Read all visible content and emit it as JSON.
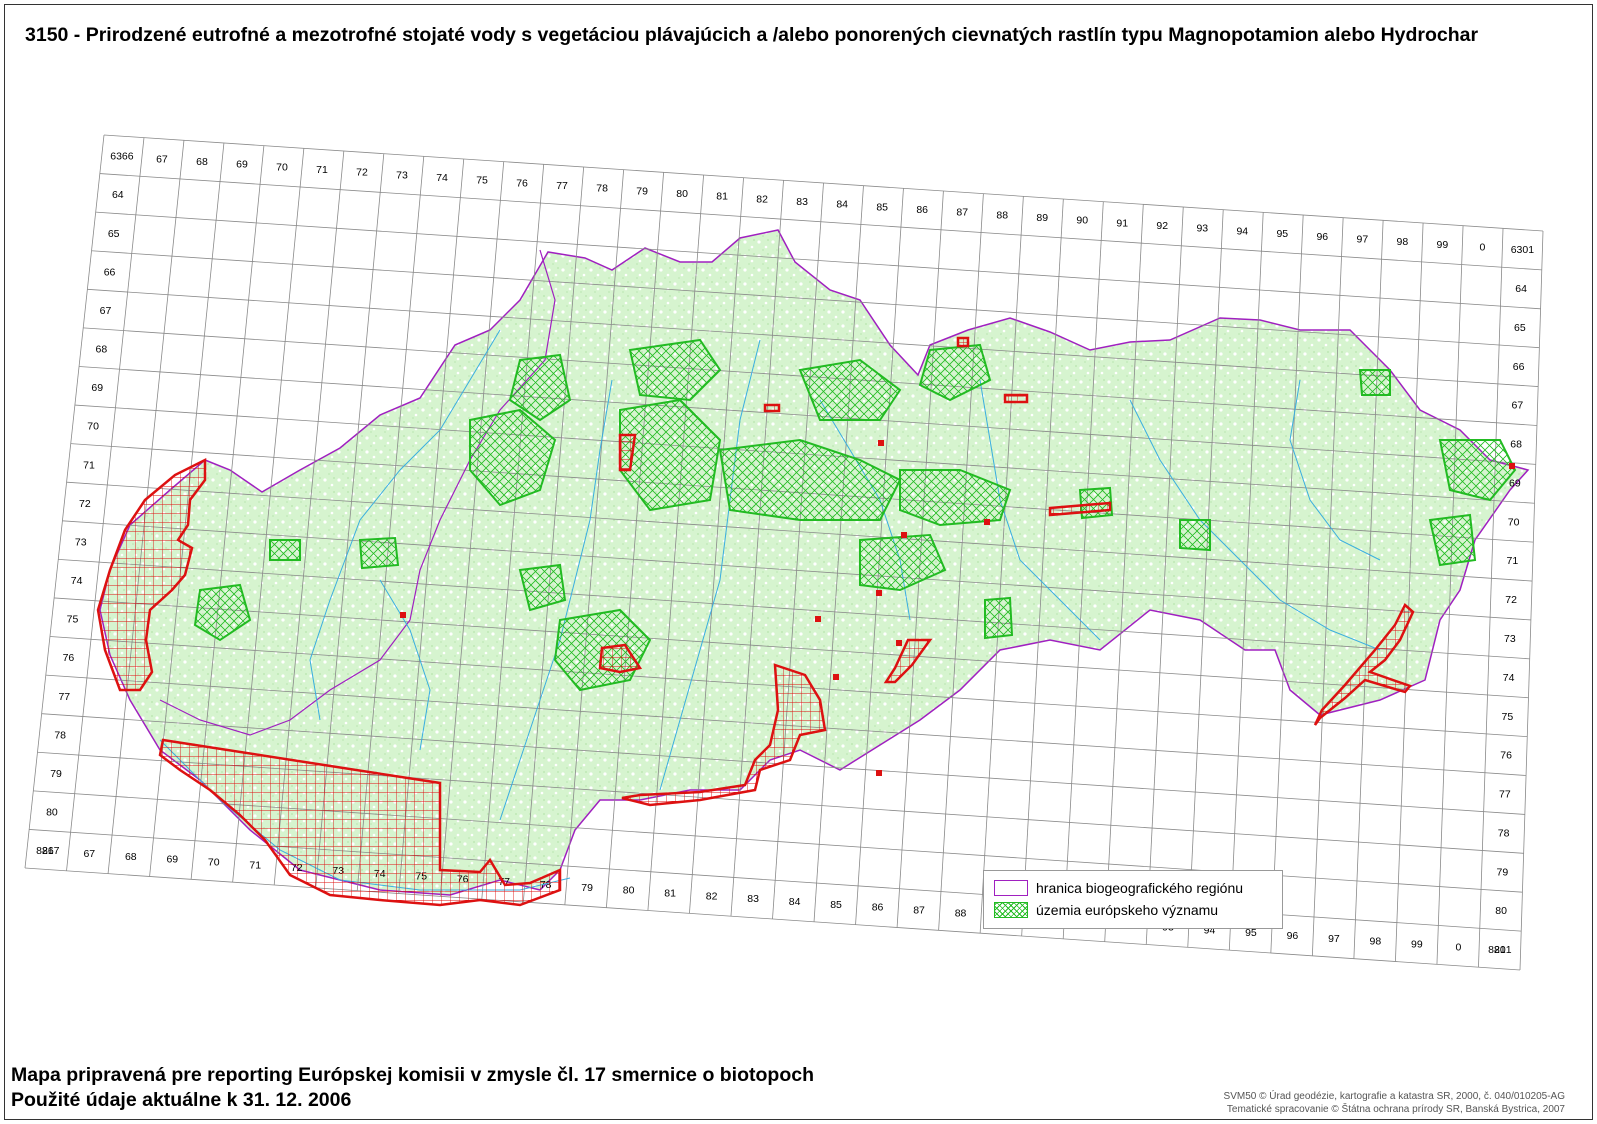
{
  "title": "3150 - Prirodzené eutrofné a mezotrofné stojaté vody s vegetáciou plávajúcich a /alebo ponorených cievnatých rastlín typu Magnopotamion alebo Hydrochar",
  "grid": {
    "top_labels": [
      "6366",
      "67",
      "68",
      "69",
      "70",
      "71",
      "72",
      "73",
      "74",
      "75",
      "76",
      "77",
      "78",
      "79",
      "80",
      "81",
      "82",
      "83",
      "84",
      "85",
      "86",
      "87",
      "88",
      "89",
      "90",
      "91",
      "92",
      "93",
      "94",
      "95",
      "96",
      "97",
      "98",
      "99",
      "0",
      "6301"
    ],
    "bottom_labels": [
      "8267",
      "67",
      "68",
      "69",
      "70",
      "71",
      "72",
      "73",
      "74",
      "75",
      "76",
      "77",
      "78",
      "79",
      "80",
      "81",
      "82",
      "83",
      "84",
      "85",
      "86",
      "87",
      "88",
      "89",
      "90",
      "91",
      "92",
      "93",
      "94",
      "95",
      "96",
      "97",
      "98",
      "99",
      "0",
      "8201"
    ],
    "left_labels": [
      "64",
      "65",
      "66",
      "67",
      "68",
      "69",
      "70",
      "71",
      "72",
      "73",
      "74",
      "75",
      "76",
      "77",
      "78",
      "79",
      "80",
      "81"
    ],
    "right_labels": [
      "64",
      "65",
      "66",
      "67",
      "68",
      "69",
      "70",
      "71",
      "72",
      "73",
      "74",
      "75",
      "76",
      "77",
      "78",
      "79",
      "80",
      "81"
    ]
  },
  "legend": {
    "items": [
      {
        "label": "hranica biogeografického regiónu",
        "color": "#a020c0"
      },
      {
        "label": "územia európskeho významu",
        "color": "#22bb22"
      }
    ]
  },
  "footer": {
    "line1": "Mapa pripravená pre reporting Európskej komisii v zmysle čl. 17 smernice o biotopoch",
    "line2": "Použité údaje aktuálne k 31. 12. 2006",
    "credit1": "SVM50 © Úrad geodézie, kartografie a katastra SR, 2000, č. 040/010205-AG",
    "credit2": "Tematické spracovanie © Štátna ochrana prírody SR, Banská Bystrica, 2007"
  },
  "colors": {
    "region_border": "#a020c0",
    "sci_sites": "#22bb22",
    "habitat_occurrence": "#dd1111",
    "land_fill": "#d8f5d2",
    "rivers": "#3aaee0"
  }
}
